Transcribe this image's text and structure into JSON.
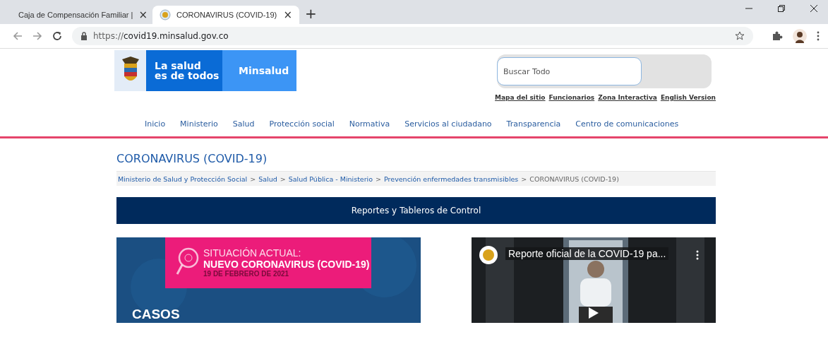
{
  "browser": {
    "tabs": [
      {
        "title": "Caja de Compensación Familiar |",
        "selected": false,
        "close": "×"
      },
      {
        "title": "CORONAVIRUS (COVID-19)",
        "selected": true,
        "close": "×"
      }
    ],
    "new_tab": "+",
    "url_scheme": "https://",
    "url_host": "covid19.minsalud.gov.co"
  },
  "header": {
    "logo_line1": "La salud",
    "logo_line2": "es de todos",
    "logo_brand": "Minsalud",
    "search": {
      "placeholder": "Buscar Todo"
    },
    "links": [
      "Mapa del sitio",
      "Funcionarios",
      "Zona Interactiva",
      "English Version"
    ]
  },
  "nav": [
    "Inicio",
    "Ministerio",
    "Salud",
    "Protección social",
    "Normativa",
    "Servicios al ciudadano",
    "Transparencia",
    "Centro de comunicaciones"
  ],
  "page_title": "CORONAVIRUS (COVID-19)",
  "breadcrumb": {
    "links": [
      "Ministerio de Salud y Protección Social",
      "Salud",
      "Salud Pública - Ministerio",
      "Prevención enfermedades transmisibles"
    ],
    "current": "CORONAVIRUS (COVID-19)",
    "separator": ">"
  },
  "section_bar": "Reportes y Tableros de Control",
  "banner": {
    "line1": "SITUACIÓN ACTUAL:",
    "line2": "NUEVO CORONAVIRUS (COVID-19)",
    "date": "19 DE FEBRERO DE 2021",
    "cases": "CASOS"
  },
  "video": {
    "kind": "picture",
    "title": "Reporte oficial de la COVID-19 pa..."
  }
}
